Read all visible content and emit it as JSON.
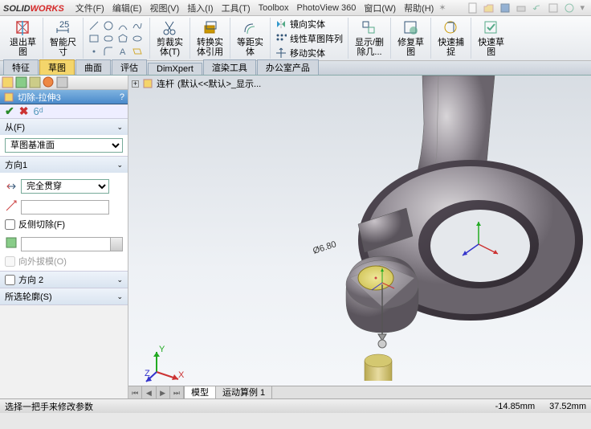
{
  "app": {
    "brand_prefix": "SOLID",
    "brand_suffix": "WORKS"
  },
  "menu": [
    "文件(F)",
    "编辑(E)",
    "视图(V)",
    "插入(I)",
    "工具(T)",
    "Toolbox",
    "PhotoView 360",
    "窗口(W)",
    "帮助(H)"
  ],
  "ribbon": {
    "exit_sketch": "退出草\n图",
    "smart_dim": "智能尺\n寸",
    "trim": "剪裁实\n体(T)",
    "convert": "转换实\n体引用",
    "offset": "等距实\n体",
    "mirror": "镜向实体",
    "linear_pattern": "线性草图阵列",
    "move": "移动实体",
    "show_hide": "显示/删\n除几...",
    "repair": "修复草\n图",
    "quick_snap": "快速捕\n捉",
    "rapid_sketch": "快速草\n图"
  },
  "tabs": [
    "特征",
    "草图",
    "曲面",
    "评估",
    "DimXpert",
    "渲染工具",
    "办公室产品"
  ],
  "active_tab_index": 1,
  "feature": {
    "title": "切除-拉伸3",
    "help": "?",
    "from_label": "从(F)",
    "from_value": "草图基准面",
    "dir1_label": "方向1",
    "dir1_value": "完全贯穿",
    "reverse_cut": "反侧切除(F)",
    "draft_outward": "向外拔模(O)",
    "dir2_label": "方向 2",
    "contours_label": "所选轮廓(S)"
  },
  "breadcrumb": {
    "part": "连杆",
    "config": "(默认<<默认>_显示..."
  },
  "dimension_label": "Ø6.80",
  "bottom_tabs": [
    "模型",
    "运动算例 1"
  ],
  "status": {
    "prompt": "选择一把手来修改参数",
    "x": "-14.85mm",
    "y": "37.52mm"
  }
}
